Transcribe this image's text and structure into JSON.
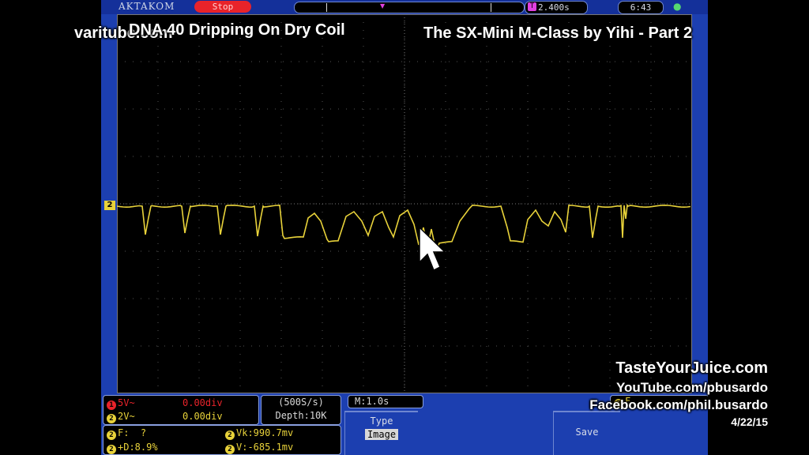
{
  "overlay": {
    "site": "varitube.com",
    "subtitle": "DNA 40 Dripping On Dry Coil",
    "title": "The SX-Mini M-Class by Yihi - Part 2",
    "credit1": "TasteYourJuice.com",
    "credit2": "YouTube.com/pbusardo",
    "credit3": "Facebook.com/phil.busardo",
    "date": "4/22/15"
  },
  "topbar": {
    "brand": "AKTAKOM",
    "run_state": "Stop",
    "timebase_badge": "T",
    "timebase": "2.400s",
    "clock": "6:43",
    "usb_icon": "usb-icon"
  },
  "screen": {
    "channel_marker": "2",
    "trace_color": "#e8d23a"
  },
  "status": {
    "ch1_badge": "1",
    "ch1_scale": "5V~",
    "ch1_offset": "0.00div",
    "ch2_badge": "2",
    "ch2_scale": "2V~",
    "ch2_offset": "0.00div",
    "sample_rate": "(500S/s)",
    "depth": "Depth:10K",
    "timebase_m": "M:1.0s",
    "freq_label": "F:",
    "freq_value": "?",
    "vk": "Vk:990.7mv",
    "duty": "+D:8.9%",
    "v": "V:-685.1mv"
  },
  "softkeys": {
    "type_label": "Type",
    "type_value": "Image",
    "save_label": "Save",
    "hidden_label": "F..."
  },
  "colors": {
    "frame": "#1c3fb0",
    "stop": "#e8232a",
    "ch2": "#e8d23a"
  }
}
